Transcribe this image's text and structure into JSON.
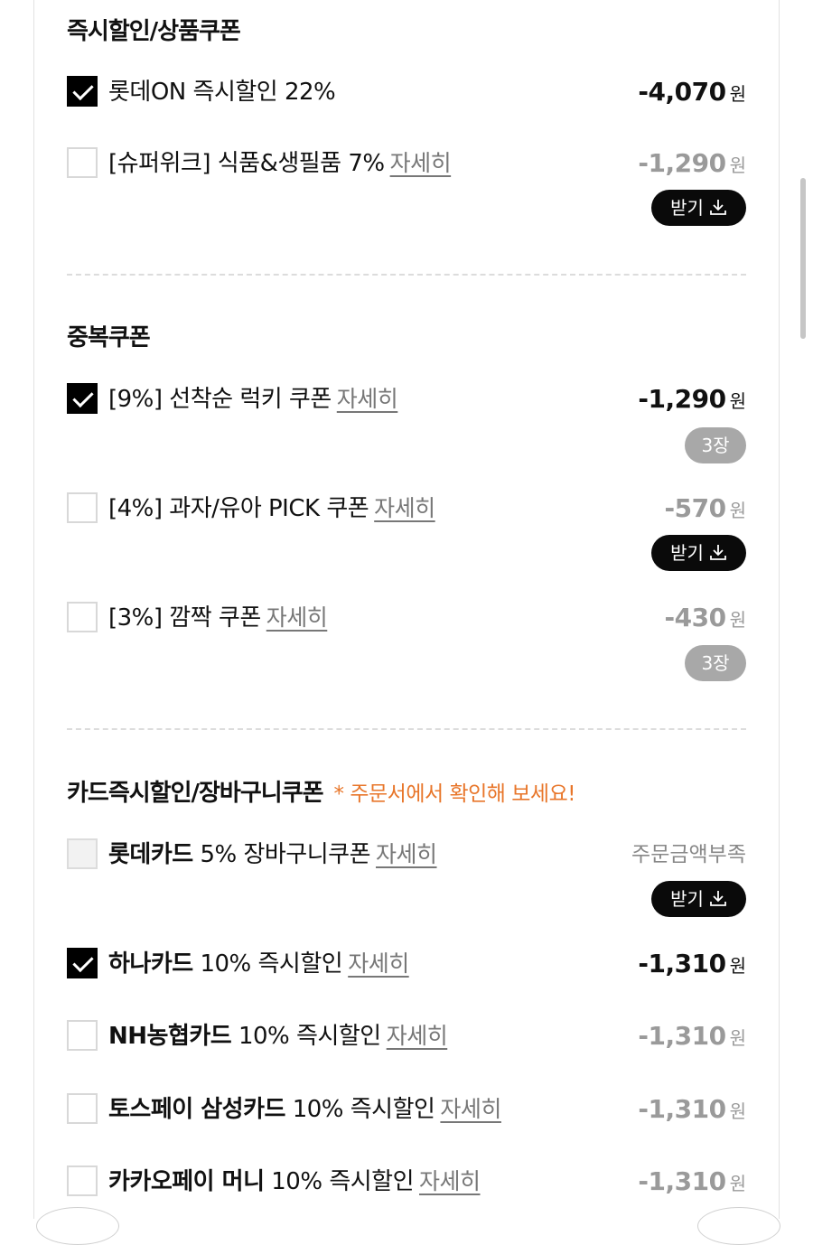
{
  "sections": {
    "instant": {
      "title": "즉시할인/상품쿠폰"
    },
    "duplicate": {
      "title": "중복쿠폰"
    },
    "card": {
      "title": "카드즉시할인/장바구니쿠폰",
      "note": "* 주문서에서 확인해 보세요!"
    }
  },
  "common": {
    "unit": "원",
    "get_label": "받기",
    "detail_label": "자세히"
  },
  "rows": {
    "r1": {
      "label": "롯데ON 즉시할인 22%",
      "amount": "-4,070",
      "checked": true
    },
    "r2": {
      "label": "[슈퍼위크] 식품&생필품 7%",
      "amount": "-1,290",
      "checked": false
    },
    "r3": {
      "label": "[9%] 선착순 럭키 쿠폰",
      "amount": "-1,290",
      "count": "3장",
      "checked": true
    },
    "r4": {
      "label": "[4%] 과자/유아 PICK 쿠폰",
      "amount": "-570",
      "checked": false
    },
    "r5": {
      "label": "[3%] 깜짝 쿠폰",
      "amount": "-430",
      "count": "3장",
      "checked": false
    },
    "r6": {
      "brand": "롯데카드",
      "label": "5% 장바구니쿠폰",
      "amount_text": "주문금액부족",
      "checked": false
    },
    "r7": {
      "brand": "하나카드",
      "label": "10% 즉시할인",
      "amount": "-1,310",
      "checked": true
    },
    "r8": {
      "brand": "NH농협카드",
      "label": "10% 즉시할인",
      "amount": "-1,310",
      "checked": false
    },
    "r9": {
      "brand": "토스페이 삼성카드",
      "label": "10% 즉시할인",
      "amount": "-1,310",
      "checked": false
    },
    "r10": {
      "brand": "카카오페이 머니",
      "label": "10% 즉시할인",
      "amount": "-1,310",
      "checked": false
    }
  },
  "colors": {
    "accent_note": "#e8762a",
    "button_dark": "#0a0a0a",
    "count_badge": "#a8a8a8"
  },
  "icons": {
    "get": "download-icon",
    "check": "checkmark-icon"
  }
}
